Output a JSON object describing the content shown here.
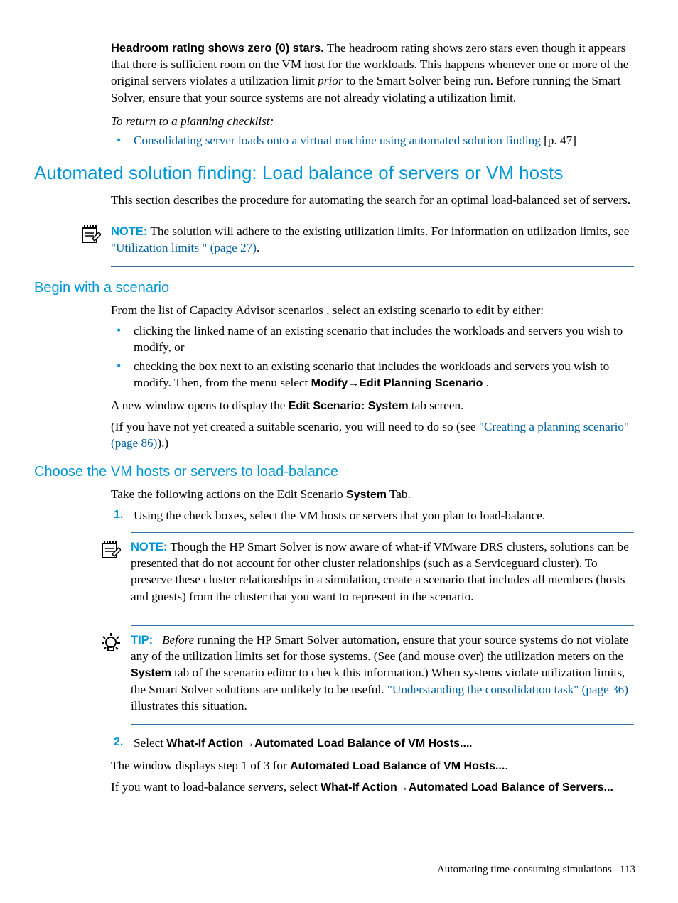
{
  "para_headroom_title": "Headroom rating shows zero (0) stars.",
  "para_headroom_body": "   The headroom rating shows zero stars even though it appears that there is sufficient room on the VM host for the workloads. This happens whenever one or more of the original servers violates a utilization limit ",
  "para_headroom_mid_italic": "prior",
  "para_headroom_tail": " to the Smart Solver being run. Before running the Smart Solver, ensure that your source systems are not already violating a utilization limit.",
  "return_line": "To return to a planning checklist:",
  "return_bullet_link": "Consolidating server loads onto a virtual machine using automated solution finding",
  "return_bullet_page": " [p. 47]",
  "h1_auto": "Automated solution finding: Load balance of servers or VM hosts",
  "para_auto_intro": "This section describes the procedure for automating the search for an optimal load-balanced set of servers.",
  "note1_label": "NOTE:",
  "note1_text_a": "   The solution will adhere to the existing utilization limits. For information on utilization limits, see ",
  "note1_link": "\"Utilization limits \" (page 27)",
  "note1_text_b": ".",
  "h2_begin": "Begin with a scenario",
  "para_begin_intro": "From the list of Capacity Advisor scenarios , select an existing scenario to edit by either:",
  "begin_bullet1": "clicking the linked name of an existing scenario that includes the workloads and servers you wish to modify, or",
  "begin_bullet2_a": "checking the box next to an existing scenario that includes the workloads and servers you wish to modify. Then, from the menu select ",
  "begin_bullet2_menu": "Modify→Edit Planning Scenario",
  "begin_bullet2_b": " .",
  "para_newwindow_a": "A new window opens to display the ",
  "para_newwindow_b": "Edit Scenario: System",
  "para_newwindow_c": " tab screen.",
  "para_ifnot_a": "(If you have not yet created a suitable scenario, you will need to do so (see ",
  "para_ifnot_link": "\"Creating a planning scenario\" (page 86)",
  "para_ifnot_b": ").)",
  "h2_choose": "Choose the VM hosts or servers to load-balance",
  "para_choose_intro_a": "Take the following actions on the Edit Scenario ",
  "para_choose_intro_b": "System",
  "para_choose_intro_c": " Tab.",
  "step1_text": "Using the check boxes, select the VM hosts or servers that you plan to load-balance.",
  "note2_label": "NOTE:",
  "note2_text": "   Though the HP Smart Solver is now aware of what-if VMware DRS clusters, solutions can be presented that do not account for other cluster relationships (such as a Serviceguard cluster). To preserve these cluster relationships in a simulation, create a scenario that includes all members (hosts and guests) from the cluster that you want to represent in the scenario.",
  "tip_label": "TIP:",
  "tip_before": "Before",
  "tip_text_a": " running the HP Smart Solver automation, ensure that your source systems do not violate any of the utilization limits set for those systems. (See (and mouse over) the utilization meters on the ",
  "tip_system": "System",
  "tip_text_b": " tab of the scenario editor to check this information.) When systems violate utilization limits, the Smart Solver solutions are unlikely to be useful. ",
  "tip_link": "\"Understanding the consolidation task\" (page 36)",
  "tip_text_c": " illustrates this situation.",
  "step2_a": "Select ",
  "step2_menu": "What-If Action→Automated Load Balance of VM Hosts...",
  "step2_b": ".",
  "para_window_a": "The window displays step 1 of 3 for ",
  "para_window_b": "Automated Load Balance of VM Hosts...",
  "para_window_c": ".",
  "para_servers_a": "If you want to load-balance ",
  "para_servers_i": "servers",
  "para_servers_b": ", select ",
  "para_servers_menu": "What-If Action→Automated Load Balance of Servers...",
  "footer_text": "Automating time-consuming simulations",
  "footer_page": "113"
}
